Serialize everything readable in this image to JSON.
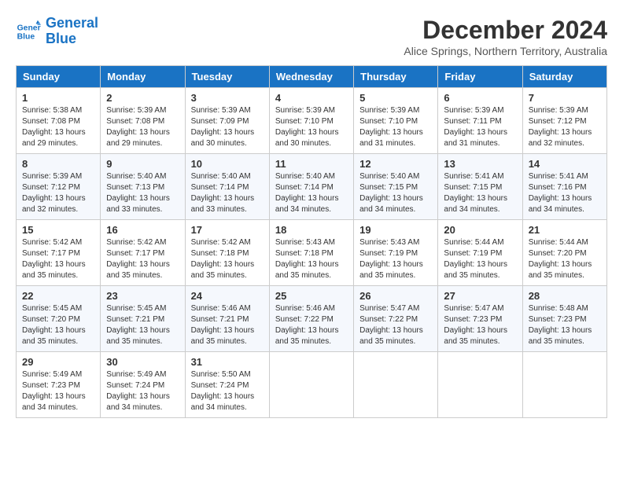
{
  "logo": {
    "line1": "General",
    "line2": "Blue"
  },
  "title": "December 2024",
  "subtitle": "Alice Springs, Northern Territory, Australia",
  "days_of_week": [
    "Sunday",
    "Monday",
    "Tuesday",
    "Wednesday",
    "Thursday",
    "Friday",
    "Saturday"
  ],
  "weeks": [
    [
      {
        "day": "1",
        "sunrise": "5:38 AM",
        "sunset": "7:08 PM",
        "daylight": "13 hours and 29 minutes."
      },
      {
        "day": "2",
        "sunrise": "5:39 AM",
        "sunset": "7:08 PM",
        "daylight": "13 hours and 29 minutes."
      },
      {
        "day": "3",
        "sunrise": "5:39 AM",
        "sunset": "7:09 PM",
        "daylight": "13 hours and 30 minutes."
      },
      {
        "day": "4",
        "sunrise": "5:39 AM",
        "sunset": "7:10 PM",
        "daylight": "13 hours and 30 minutes."
      },
      {
        "day": "5",
        "sunrise": "5:39 AM",
        "sunset": "7:10 PM",
        "daylight": "13 hours and 31 minutes."
      },
      {
        "day": "6",
        "sunrise": "5:39 AM",
        "sunset": "7:11 PM",
        "daylight": "13 hours and 31 minutes."
      },
      {
        "day": "7",
        "sunrise": "5:39 AM",
        "sunset": "7:12 PM",
        "daylight": "13 hours and 32 minutes."
      }
    ],
    [
      {
        "day": "8",
        "sunrise": "5:39 AM",
        "sunset": "7:12 PM",
        "daylight": "13 hours and 32 minutes."
      },
      {
        "day": "9",
        "sunrise": "5:40 AM",
        "sunset": "7:13 PM",
        "daylight": "13 hours and 33 minutes."
      },
      {
        "day": "10",
        "sunrise": "5:40 AM",
        "sunset": "7:14 PM",
        "daylight": "13 hours and 33 minutes."
      },
      {
        "day": "11",
        "sunrise": "5:40 AM",
        "sunset": "7:14 PM",
        "daylight": "13 hours and 34 minutes."
      },
      {
        "day": "12",
        "sunrise": "5:40 AM",
        "sunset": "7:15 PM",
        "daylight": "13 hours and 34 minutes."
      },
      {
        "day": "13",
        "sunrise": "5:41 AM",
        "sunset": "7:15 PM",
        "daylight": "13 hours and 34 minutes."
      },
      {
        "day": "14",
        "sunrise": "5:41 AM",
        "sunset": "7:16 PM",
        "daylight": "13 hours and 34 minutes."
      }
    ],
    [
      {
        "day": "15",
        "sunrise": "5:42 AM",
        "sunset": "7:17 PM",
        "daylight": "13 hours and 35 minutes."
      },
      {
        "day": "16",
        "sunrise": "5:42 AM",
        "sunset": "7:17 PM",
        "daylight": "13 hours and 35 minutes."
      },
      {
        "day": "17",
        "sunrise": "5:42 AM",
        "sunset": "7:18 PM",
        "daylight": "13 hours and 35 minutes."
      },
      {
        "day": "18",
        "sunrise": "5:43 AM",
        "sunset": "7:18 PM",
        "daylight": "13 hours and 35 minutes."
      },
      {
        "day": "19",
        "sunrise": "5:43 AM",
        "sunset": "7:19 PM",
        "daylight": "13 hours and 35 minutes."
      },
      {
        "day": "20",
        "sunrise": "5:44 AM",
        "sunset": "7:19 PM",
        "daylight": "13 hours and 35 minutes."
      },
      {
        "day": "21",
        "sunrise": "5:44 AM",
        "sunset": "7:20 PM",
        "daylight": "13 hours and 35 minutes."
      }
    ],
    [
      {
        "day": "22",
        "sunrise": "5:45 AM",
        "sunset": "7:20 PM",
        "daylight": "13 hours and 35 minutes."
      },
      {
        "day": "23",
        "sunrise": "5:45 AM",
        "sunset": "7:21 PM",
        "daylight": "13 hours and 35 minutes."
      },
      {
        "day": "24",
        "sunrise": "5:46 AM",
        "sunset": "7:21 PM",
        "daylight": "13 hours and 35 minutes."
      },
      {
        "day": "25",
        "sunrise": "5:46 AM",
        "sunset": "7:22 PM",
        "daylight": "13 hours and 35 minutes."
      },
      {
        "day": "26",
        "sunrise": "5:47 AM",
        "sunset": "7:22 PM",
        "daylight": "13 hours and 35 minutes."
      },
      {
        "day": "27",
        "sunrise": "5:47 AM",
        "sunset": "7:23 PM",
        "daylight": "13 hours and 35 minutes."
      },
      {
        "day": "28",
        "sunrise": "5:48 AM",
        "sunset": "7:23 PM",
        "daylight": "13 hours and 35 minutes."
      }
    ],
    [
      {
        "day": "29",
        "sunrise": "5:49 AM",
        "sunset": "7:23 PM",
        "daylight": "13 hours and 34 minutes."
      },
      {
        "day": "30",
        "sunrise": "5:49 AM",
        "sunset": "7:24 PM",
        "daylight": "13 hours and 34 minutes."
      },
      {
        "day": "31",
        "sunrise": "5:50 AM",
        "sunset": "7:24 PM",
        "daylight": "13 hours and 34 minutes."
      },
      null,
      null,
      null,
      null
    ]
  ]
}
